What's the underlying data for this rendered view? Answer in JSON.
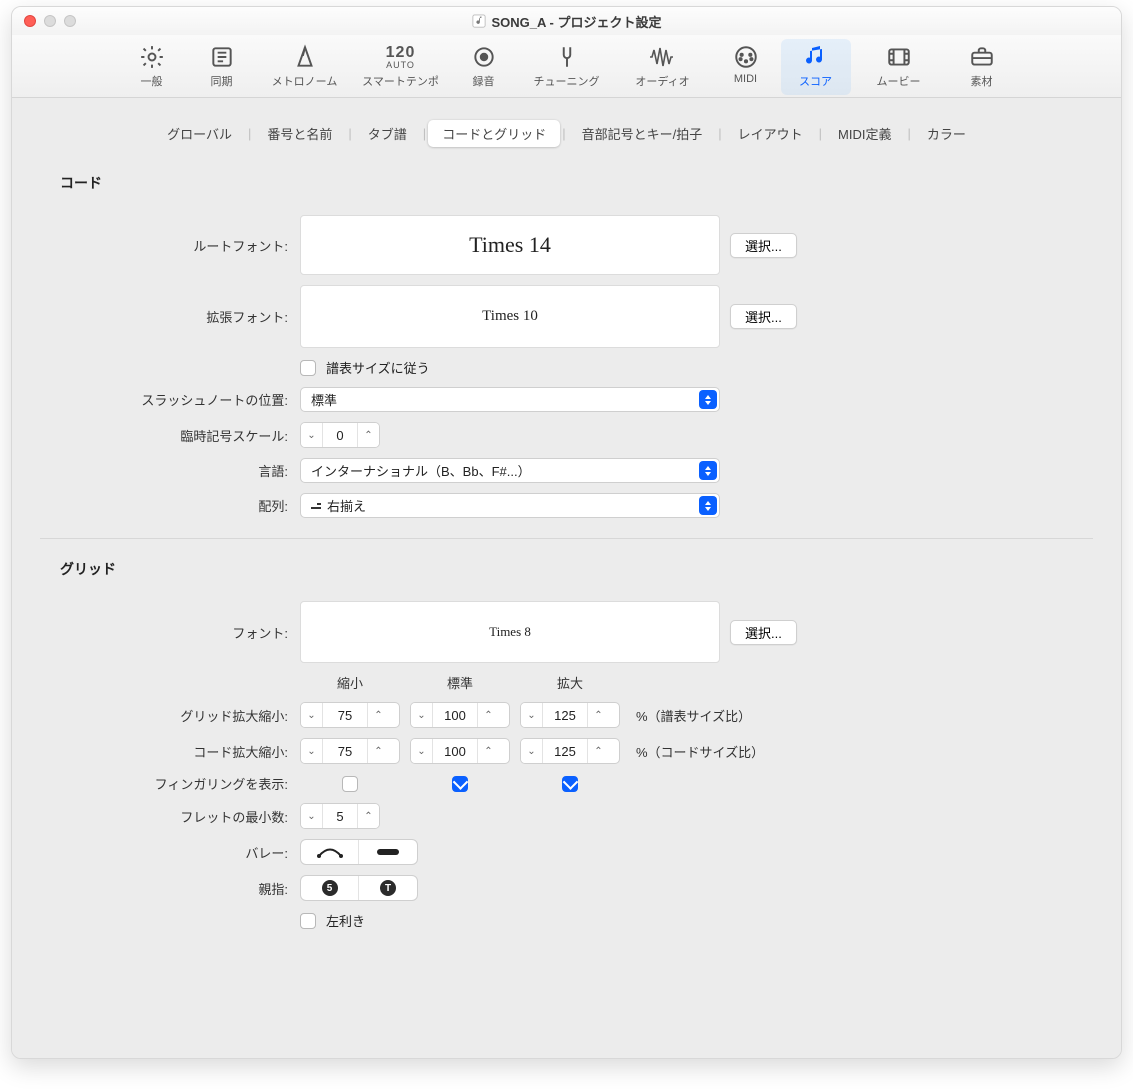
{
  "window": {
    "title": "SONG_A - プロジェクト設定"
  },
  "toolbar": [
    {
      "id": "general",
      "label": "一般"
    },
    {
      "id": "sync",
      "label": "同期"
    },
    {
      "id": "metronome",
      "label": "メトロノーム"
    },
    {
      "id": "smarttempo",
      "label": "スマートテンポ",
      "num": "120",
      "auto": "AUTO"
    },
    {
      "id": "record",
      "label": "録音"
    },
    {
      "id": "tuning",
      "label": "チューニング"
    },
    {
      "id": "audio",
      "label": "オーディオ"
    },
    {
      "id": "midi",
      "label": "MIDI"
    },
    {
      "id": "score",
      "label": "スコア",
      "active": true
    },
    {
      "id": "movie",
      "label": "ムービー"
    },
    {
      "id": "assets",
      "label": "素材"
    }
  ],
  "subtabs": [
    {
      "label": "グローバル"
    },
    {
      "label": "番号と名前"
    },
    {
      "label": "タブ譜"
    },
    {
      "label": "コードとグリッド",
      "active": true
    },
    {
      "label": "音部記号とキー/拍子"
    },
    {
      "label": "レイアウト"
    },
    {
      "label": "MIDI定義"
    },
    {
      "label": "カラー"
    }
  ],
  "chord": {
    "title": "コード",
    "root_font": {
      "label": "ルートフォント:",
      "value": "Times 14",
      "choose": "選択..."
    },
    "ext_font": {
      "label": "拡張フォント:",
      "value": "Times 10",
      "choose": "選択..."
    },
    "follow_staff": {
      "label": "譜表サイズに従う",
      "checked": false
    },
    "slash_pos": {
      "label": "スラッシュノートの位置:",
      "value": "標準"
    },
    "acc_scale": {
      "label": "臨時記号スケール:",
      "value": "0"
    },
    "language": {
      "label": "言語:",
      "value": "インターナショナル（B、Bb、F#...）"
    },
    "align": {
      "label": "配列:",
      "value": "右揃え"
    }
  },
  "grid": {
    "title": "グリッド",
    "font": {
      "label": "フォント:",
      "value": "Times 8",
      "choose": "選択..."
    },
    "cols": {
      "small": "縮小",
      "normal": "標準",
      "large": "拡大"
    },
    "grid_scale": {
      "label": "グリッド拡大縮小:",
      "small": "75",
      "normal": "100",
      "large": "125",
      "suffix": "%（譜表サイズ比）"
    },
    "chord_scale": {
      "label": "コード拡大縮小:",
      "small": "75",
      "normal": "100",
      "large": "125",
      "suffix": "%（コードサイズ比）"
    },
    "fingering": {
      "label": "フィンガリングを表示:",
      "small": false,
      "normal": true,
      "large": true
    },
    "min_frets": {
      "label": "フレットの最小数:",
      "value": "5"
    },
    "barre": {
      "label": "バレー:"
    },
    "thumb": {
      "label": "親指:",
      "opt1": "5",
      "opt2": "T"
    },
    "lefty": {
      "label": "左利き",
      "checked": false
    }
  }
}
